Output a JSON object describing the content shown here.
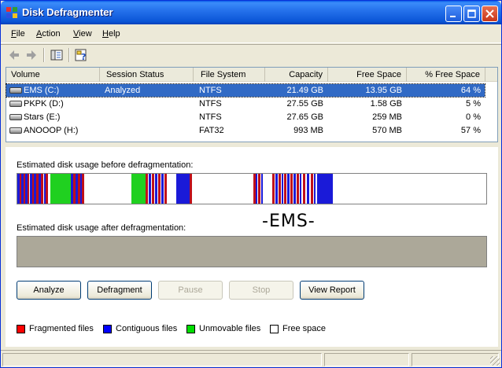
{
  "window": {
    "title": "Disk Defragmenter"
  },
  "menu": [
    {
      "key": "F",
      "rest": "ile"
    },
    {
      "key": "A",
      "rest": "ction"
    },
    {
      "key": "V",
      "rest": "iew"
    },
    {
      "key": "H",
      "rest": "elp"
    }
  ],
  "columns": [
    "Volume",
    "Session Status",
    "File System",
    "Capacity",
    "Free Space",
    "% Free Space"
  ],
  "volumes": [
    {
      "volume": "EMS (C:)",
      "status": "Analyzed",
      "fs": "NTFS",
      "capacity": "21.49 GB",
      "free": "13.95 GB",
      "pct": "64 %",
      "selected": true
    },
    {
      "volume": "PKPK (D:)",
      "status": "",
      "fs": "NTFS",
      "capacity": "27.55 GB",
      "free": "1.58 GB",
      "pct": "5 %",
      "selected": false
    },
    {
      "volume": "Stars (E:)",
      "status": "",
      "fs": "NTFS",
      "capacity": "27.65 GB",
      "free": "259 MB",
      "pct": "0 %",
      "selected": false
    },
    {
      "volume": "ANOOOP (H:)",
      "status": "",
      "fs": "FAT32",
      "capacity": "993 MB",
      "free": "570 MB",
      "pct": "57 %",
      "selected": false
    }
  ],
  "pane": {
    "before_label": "Estimated disk usage before defragmentation:",
    "after_label": "Estimated disk usage after defragmentation:",
    "watermark": "-EMS-"
  },
  "buttons": {
    "analyze": "Analyze",
    "defragment": "Defragment",
    "pause": "Pause",
    "stop": "Stop",
    "view_report": "View Report"
  },
  "legend": [
    {
      "label": "Fragmented files",
      "color": "#ff0000"
    },
    {
      "label": "Contiguous files",
      "color": "#0000ff"
    },
    {
      "label": "Unmovable files",
      "color": "#00dd00"
    },
    {
      "label": "Free space",
      "color": "#ffffff"
    }
  ],
  "colors": {
    "fragmented": "#c0101a",
    "contiguous": "#1a1ad8",
    "unmovable": "#20d020",
    "free": "#ffffff",
    "selection": "#316ac5"
  }
}
